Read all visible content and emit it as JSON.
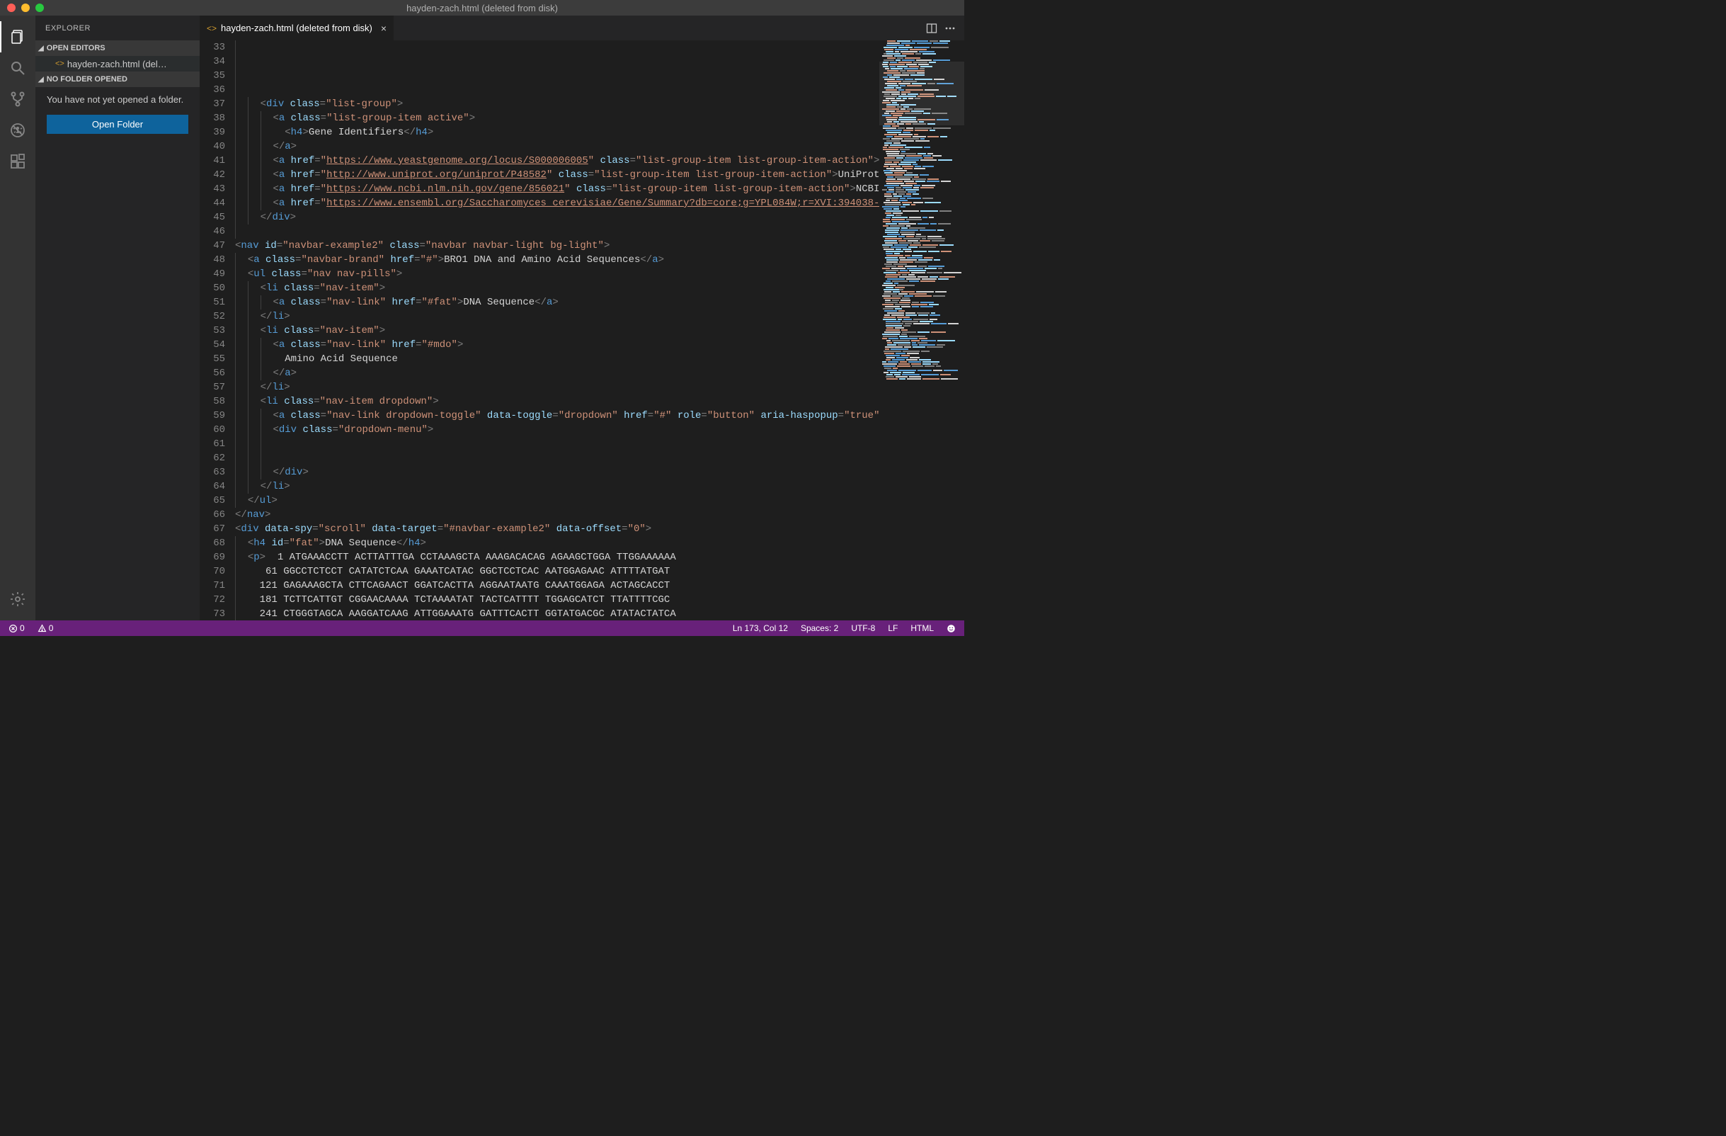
{
  "titlebar": {
    "title": "hayden-zach.html (deleted from disk)"
  },
  "sidebar": {
    "header": "EXPLORER",
    "open_editors_label": "OPEN EDITORS",
    "open_editor_item": "hayden-zach.html (del…",
    "no_folder_label": "NO FOLDER OPENED",
    "no_folder_message": "You have not yet opened a folder.",
    "open_folder_btn": "Open Folder"
  },
  "tab": {
    "label": "hayden-zach.html (deleted from disk)"
  },
  "gutter": {
    "start": 33,
    "end": 73
  },
  "code": {
    "t41_href": "https://www.yeastgenome.org/locus/S000006005",
    "t42_href": "http://www.uniprot.org/uniprot/P48582",
    "t42_txt": "UniProt",
    "t43_href": "https://www.ncbi.nlm.nih.gov/gene/856021",
    "t43_txt": "NCBI",
    "t44_href": "https://www.ensembl.org/Saccharomyces_cerevisiae/Gene/Summary?db=core;g=YPL084W;r=XVI:394038-",
    "t38_txt": "Gene Identifiers",
    "t48_txt": "BRO1 DNA and Amino Acid Sequences",
    "t51_txt": "DNA Sequence",
    "t55_txt": "Amino Acid Sequence",
    "t67_txt_id": "#navbar-example2",
    "t68_txt": "DNA Sequence",
    "t69_txt": "  1 ATGAAACCTT ACTTATTTGA CCTAAAGCTA AAAGACACAG AGAAGCTGGA TTGGAAAAAA",
    "t70_txt": " 61 GGCCTCTCCT CATATCTCAA GAAATCATAC GGCTCCTCAC AATGGAGAAC ATTTTATGAT",
    "t71_txt": "121 GAGAAAGCTA CTTCAGAACT GGATCACTTA AGGAATAATG CAAATGGAGA ACTAGCACCT",
    "t72_txt": "181 TCTTCATTGT CGGAACAAAA TCTAAAATAT TACTCATTTT TGGAGCATCT TTATTTTCGC",
    "t73_txt": "241 CTGGGTAGCA AAGGATCAAG ATTGGAAATG GATTTCACTT GGTATGACGC ATATACTATCA"
  },
  "status": {
    "errors": "0",
    "warnings": "0",
    "line_col": "Ln 173, Col 12",
    "spaces": "Spaces: 2",
    "encoding": "UTF-8",
    "eol": "LF",
    "language": "HTML"
  }
}
